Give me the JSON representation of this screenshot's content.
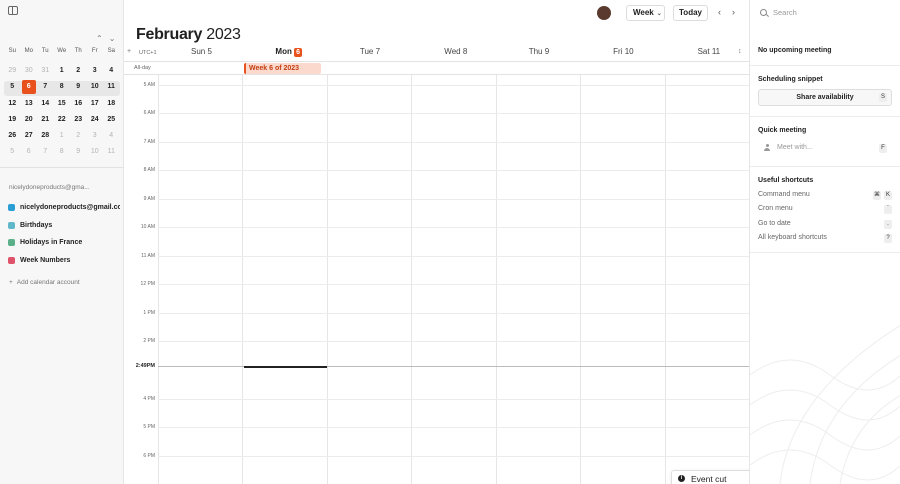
{
  "mini_calendar": {
    "weekdays": [
      "Su",
      "Mo",
      "Tu",
      "We",
      "Th",
      "Fr",
      "Sa"
    ],
    "weeks": [
      [
        {
          "d": "29",
          "m": true
        },
        {
          "d": "30",
          "m": true
        },
        {
          "d": "31",
          "m": true
        },
        {
          "d": "1"
        },
        {
          "d": "2"
        },
        {
          "d": "3"
        },
        {
          "d": "4"
        }
      ],
      [
        {
          "d": "5"
        },
        {
          "d": "6",
          "today": true
        },
        {
          "d": "7"
        },
        {
          "d": "8"
        },
        {
          "d": "9"
        },
        {
          "d": "10"
        },
        {
          "d": "11"
        }
      ],
      [
        {
          "d": "12"
        },
        {
          "d": "13"
        },
        {
          "d": "14"
        },
        {
          "d": "15"
        },
        {
          "d": "16"
        },
        {
          "d": "17"
        },
        {
          "d": "18"
        }
      ],
      [
        {
          "d": "19"
        },
        {
          "d": "20"
        },
        {
          "d": "21"
        },
        {
          "d": "22"
        },
        {
          "d": "23"
        },
        {
          "d": "24"
        },
        {
          "d": "25"
        }
      ],
      [
        {
          "d": "26"
        },
        {
          "d": "27"
        },
        {
          "d": "28"
        },
        {
          "d": "1",
          "m": true
        },
        {
          "d": "2",
          "m": true
        },
        {
          "d": "3",
          "m": true
        },
        {
          "d": "4",
          "m": true
        }
      ],
      [
        {
          "d": "5",
          "m": true
        },
        {
          "d": "6",
          "m": true
        },
        {
          "d": "7",
          "m": true
        },
        {
          "d": "8",
          "m": true
        },
        {
          "d": "9",
          "m": true
        },
        {
          "d": "10",
          "m": true
        },
        {
          "d": "11",
          "m": true
        }
      ]
    ]
  },
  "sidebar": {
    "account_label": "nicelydoneproducts@gma...",
    "calendars": [
      {
        "name": "nicelydoneproducts@gmail.com",
        "color": "#2b9fd4"
      },
      {
        "name": "Birthdays",
        "color": "#5fb8c9"
      },
      {
        "name": "Holidays in France",
        "color": "#5bb08a"
      },
      {
        "name": "Week Numbers",
        "color": "#e0526a"
      }
    ],
    "add_account_label": "Add calendar account"
  },
  "header": {
    "month": "February",
    "year": "2023",
    "view_label": "Week",
    "today_label": "Today"
  },
  "week": {
    "timezone": "UTC+1",
    "allday_label": "All-day",
    "days": [
      {
        "name": "Sun",
        "num": "5"
      },
      {
        "name": "Mon",
        "num": "6",
        "today": true
      },
      {
        "name": "Tue",
        "num": "7"
      },
      {
        "name": "Wed",
        "num": "8"
      },
      {
        "name": "Thu",
        "num": "9"
      },
      {
        "name": "Fri",
        "num": "10"
      },
      {
        "name": "Sat",
        "num": "11"
      }
    ],
    "allday_event": "Week 6 of 2023",
    "hours": [
      "5 AM",
      "6 AM",
      "7 AM",
      "8 AM",
      "9 AM",
      "10 AM",
      "11 AM",
      "12 PM",
      "1 PM",
      "2 PM",
      "4 PM",
      "5 PM",
      "6 PM"
    ],
    "now_label": "2:49PM"
  },
  "toast": {
    "text": "Event cut"
  },
  "right_panel": {
    "search_placeholder": "Search",
    "no_upcoming": "No upcoming meeting",
    "scheduling_title": "Scheduling snippet",
    "share_label": "Share availability",
    "share_key": "S",
    "quick_title": "Quick meeting",
    "quick_placeholder": "Meet with...",
    "quick_key": "F",
    "shortcuts_title": "Useful shortcuts",
    "shortcuts": [
      {
        "label": "Command menu",
        "keys": [
          "⌘",
          "K"
        ]
      },
      {
        "label": "Cron menu",
        "keys": [
          "`"
        ]
      },
      {
        "label": "Go to date",
        "keys": [
          "."
        ]
      },
      {
        "label": "All keyboard shortcuts",
        "keys": [
          "?"
        ]
      }
    ]
  },
  "colors": {
    "accent": "#e9511c",
    "event_bg": "#fbd9cd"
  }
}
